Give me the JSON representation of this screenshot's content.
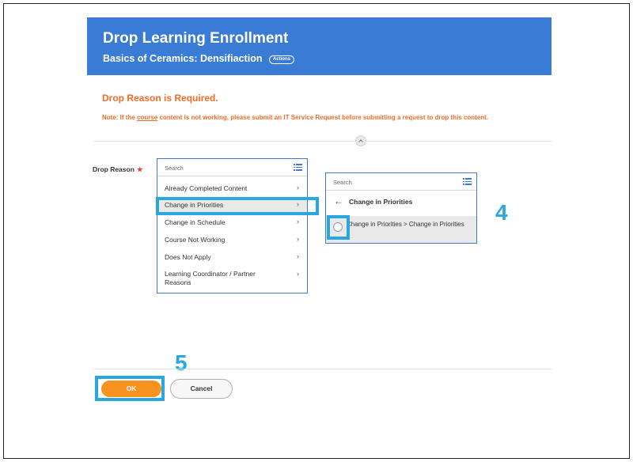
{
  "header": {
    "title": "Drop Learning Enrollment",
    "subtitle": "Basics of Ceramics: Densifiaction",
    "actions_label": "Actions",
    "color": "#3a7bd5"
  },
  "errors": {
    "title": "Drop Reason is Required.",
    "note_before": "Note: If the ",
    "note_link": "course",
    "note_after": " content is not working, please submit an IT Service Request before submitting a request to drop this content.",
    "color": "#f26b2a"
  },
  "form": {
    "field_label": "Drop Reason",
    "required_marker": "★",
    "search_placeholder": "Search",
    "options": [
      {
        "label": "Already Completed Content"
      },
      {
        "label": "Change in Priorities",
        "selected": true
      },
      {
        "label": "Change in Schedule"
      },
      {
        "label": "Course Not Working"
      },
      {
        "label": "Does Not Apply"
      },
      {
        "label": "Learning Coordinator / Partner Reasons"
      }
    ],
    "chevron": "›"
  },
  "submenu": {
    "search_placeholder": "Search",
    "back_arrow": "←",
    "title": "Change in Priorities",
    "option": "Change in Priorities > Change in Priorities"
  },
  "steps": {
    "step4": "4",
    "step5": "5",
    "highlight_color": "#29a8df"
  },
  "buttons": {
    "ok": "OK",
    "cancel": "Cancel",
    "ok_color": "#f7931e"
  }
}
